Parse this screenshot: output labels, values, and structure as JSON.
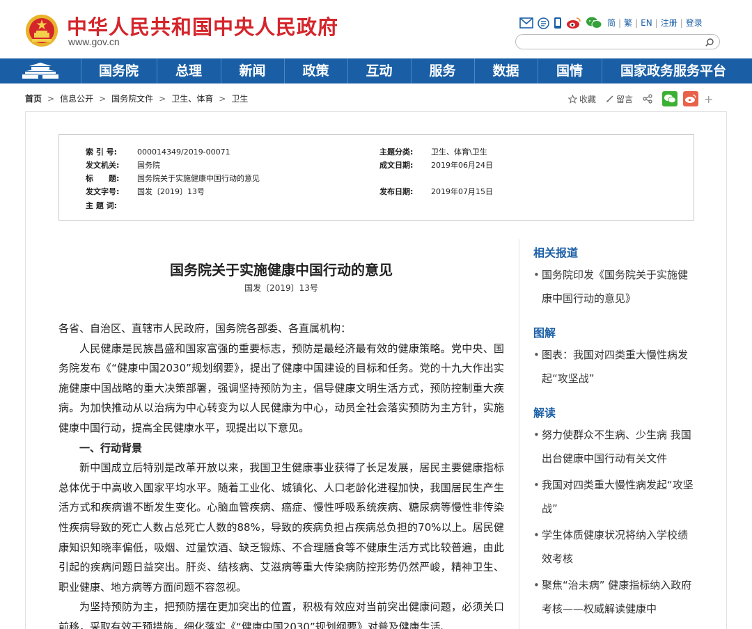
{
  "header": {
    "title": "中华人民共和国中央人民政府",
    "url": "www.gov.cn",
    "icons": [
      "mail-icon",
      "rss-icon",
      "mobile-icon",
      "weibo-icon",
      "wechat-icon"
    ],
    "links": [
      "简",
      "繁",
      "EN",
      "注册",
      "登录"
    ],
    "search_placeholder": "",
    "brand_red": "#d4252b",
    "brand_blue": "#1a5fa6"
  },
  "nav": {
    "items": [
      "国务院",
      "总理",
      "新闻",
      "政策",
      "互动",
      "服务",
      "数据",
      "国情",
      "国家政务服务平台"
    ]
  },
  "breadcrumb": {
    "items": [
      "首页",
      "信息公开",
      "国务院文件",
      "卫生、体育",
      "卫生"
    ]
  },
  "actions": {
    "favorite": "收藏",
    "comment": "留言"
  },
  "meta": {
    "index_label": "索 引 号:",
    "index_value": "000014349/2019-00071",
    "topic_label": "主题分类:",
    "topic_value": "卫生、体育\\卫生",
    "issuer_label": "发文机关:",
    "issuer_value": "国务院",
    "date_label": "成文日期:",
    "date_value": "2019年06月24日",
    "title_label": "标　　题:",
    "title_value": "国务院关于实施健康中国行动的意见",
    "docno_label": "发文字号:",
    "docno_value": "国发〔2019〕13号",
    "pubdate_label": "发布日期:",
    "pubdate_value": "2019年07月15日",
    "keywords_label": "主 题 词:"
  },
  "article": {
    "title": "国务院关于实施健康中国行动的意见",
    "docno": "国发〔2019〕13号",
    "salutation": "各省、自治区、直辖市人民政府，国务院各部委、各直属机构：",
    "para1": "人民健康是民族昌盛和国家富强的重要标志，预防是最经济最有效的健康策略。党中央、国务院发布《“健康中国2030”规划纲要》，提出了健康中国建设的目标和任务。党的十九大作出实施健康中国战略的重大决策部署，强调坚持预防为主，倡导健康文明生活方式，预防控制重大疾病。为加快推动从以治病为中心转变为以人民健康为中心，动员全社会落实预防为主方针，实施健康中国行动，提高全民健康水平，现提出以下意见。",
    "heading1": "一、行动背景",
    "para2": "新中国成立后特别是改革开放以来，我国卫生健康事业获得了长足发展，居民主要健康指标总体优于中高收入国家平均水平。随着工业化、城镇化、人口老龄化进程加快，我国居民生产生活方式和疾病谱不断发生变化。心脑血管疾病、癌症、慢性呼吸系统疾病、糖尿病等慢性非传染性疾病导致的死亡人数占总死亡人数的88%，导致的疾病负担占疾病总负担的70%以上。居民健康知识知晓率偏低，吸烟、过量饮酒、缺乏锻炼、不合理膳食等不健康生活方式比较普遍，由此引起的疾病问题日益突出。肝炎、结核病、艾滋病等重大传染病防控形势仍然严峻，精神卫生、职业健康、地方病等方面问题不容忽视。",
    "para3": "为坚持预防为主，把预防摆在更加突出的位置，积极有效应对当前突出健康问题，必须关口前移，采取有效干预措施，细化落实《“健康中国2030”规划纲要》对普及健康生活、"
  },
  "sidebar": {
    "related_heading": "相关报道",
    "related": [
      "国务院印发《国务院关于实施健康中国行动的意见》"
    ],
    "graphic_heading": "图解",
    "graphic": [
      "图表：我国对四类重大慢性病发起“攻坚战”"
    ],
    "interp_heading": "解读",
    "interp": [
      "努力使群众不生病、少生病 我国出台健康中国行动有关文件",
      "我国对四类重大慢性病发起“攻坚战”",
      "学生体质健康状况将纳入学校绩效考核",
      "聚焦“治未病” 健康指标纳入政府考核——权威解读健康中"
    ]
  }
}
